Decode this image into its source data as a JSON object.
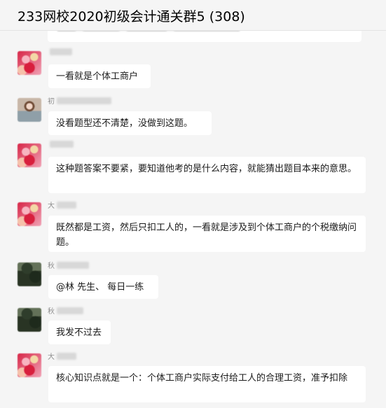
{
  "window": {
    "title": "233网校2020初级会计通关群5 (308)"
  },
  "messages": [
    {
      "sender_prefix": "",
      "text": "一看就是个体工商户"
    },
    {
      "sender_prefix": "初",
      "text": "没看题型还不清楚，没做到这题。"
    },
    {
      "sender_prefix": "",
      "text": "这种题答案不要紧，要知道他考的是什么内容，就能猜出题目本来的意思。"
    },
    {
      "sender_prefix": "大",
      "text": "既然都是工资，然后只扣工人的，一看就是涉及到个体工商户的个税缴纳问题。"
    },
    {
      "sender_prefix": "秋",
      "text": "@林  先生、 每日一练"
    },
    {
      "sender_prefix": "秋",
      "text": "我发不过去"
    },
    {
      "sender_prefix": "大",
      "text": "核心知识点就是一个：个体工商户实际支付给工人的合理工资，准予扣除"
    }
  ],
  "avatars": [
    "red-floral-avatar-icon",
    "person-avatar-icon",
    "red-floral-avatar-icon",
    "red-floral-avatar-icon",
    "tree-avatar-icon",
    "tree-avatar-icon",
    "red-floral-avatar-icon"
  ]
}
